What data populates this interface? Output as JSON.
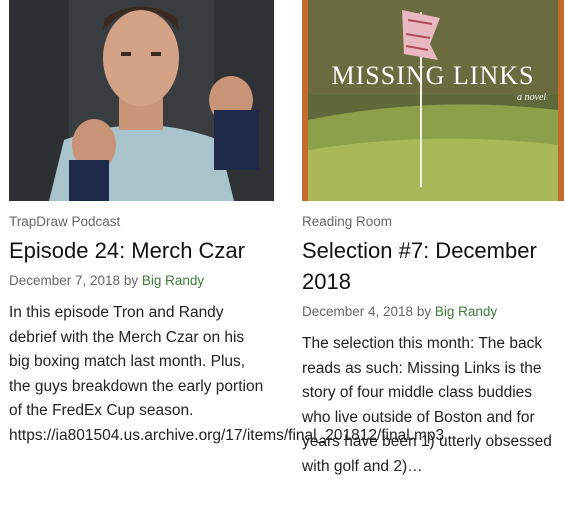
{
  "posts": [
    {
      "image_alt": "Man in boxing stance with wrapped fists",
      "category": "TrapDraw Podcast",
      "title": "Episode 24: Merch Czar",
      "date": "December 7, 2018",
      "by": "by",
      "author": "Big Randy",
      "excerpt": "In this episode Tron and Randy debrief with the Merch Czar on his big boxing match last month. Plus, the guys breakdown the early portion of the FredEx Cup season.",
      "excerpt_url": "https://ia801504.us.archive.org/17/items/final_201812/final.mp3"
    },
    {
      "image_alt": "Missing Links book cover with golf flag",
      "cover_title": "MISSING LINKS",
      "cover_subtitle": "a novel",
      "category": "Reading Room",
      "title": "Selection #7: December 2018",
      "date": "December 4, 2018",
      "by": "by",
      "author": "Big Randy",
      "excerpt": "The selection this month: The back reads as such: Missing Links is the story of four middle class buddies who live outside of Boston and for years have been 1) utterly obsessed with golf and 2)…"
    }
  ],
  "colors": {
    "author_link": "#3e7b3a",
    "meta_text": "#666666",
    "body_text": "#222222"
  }
}
